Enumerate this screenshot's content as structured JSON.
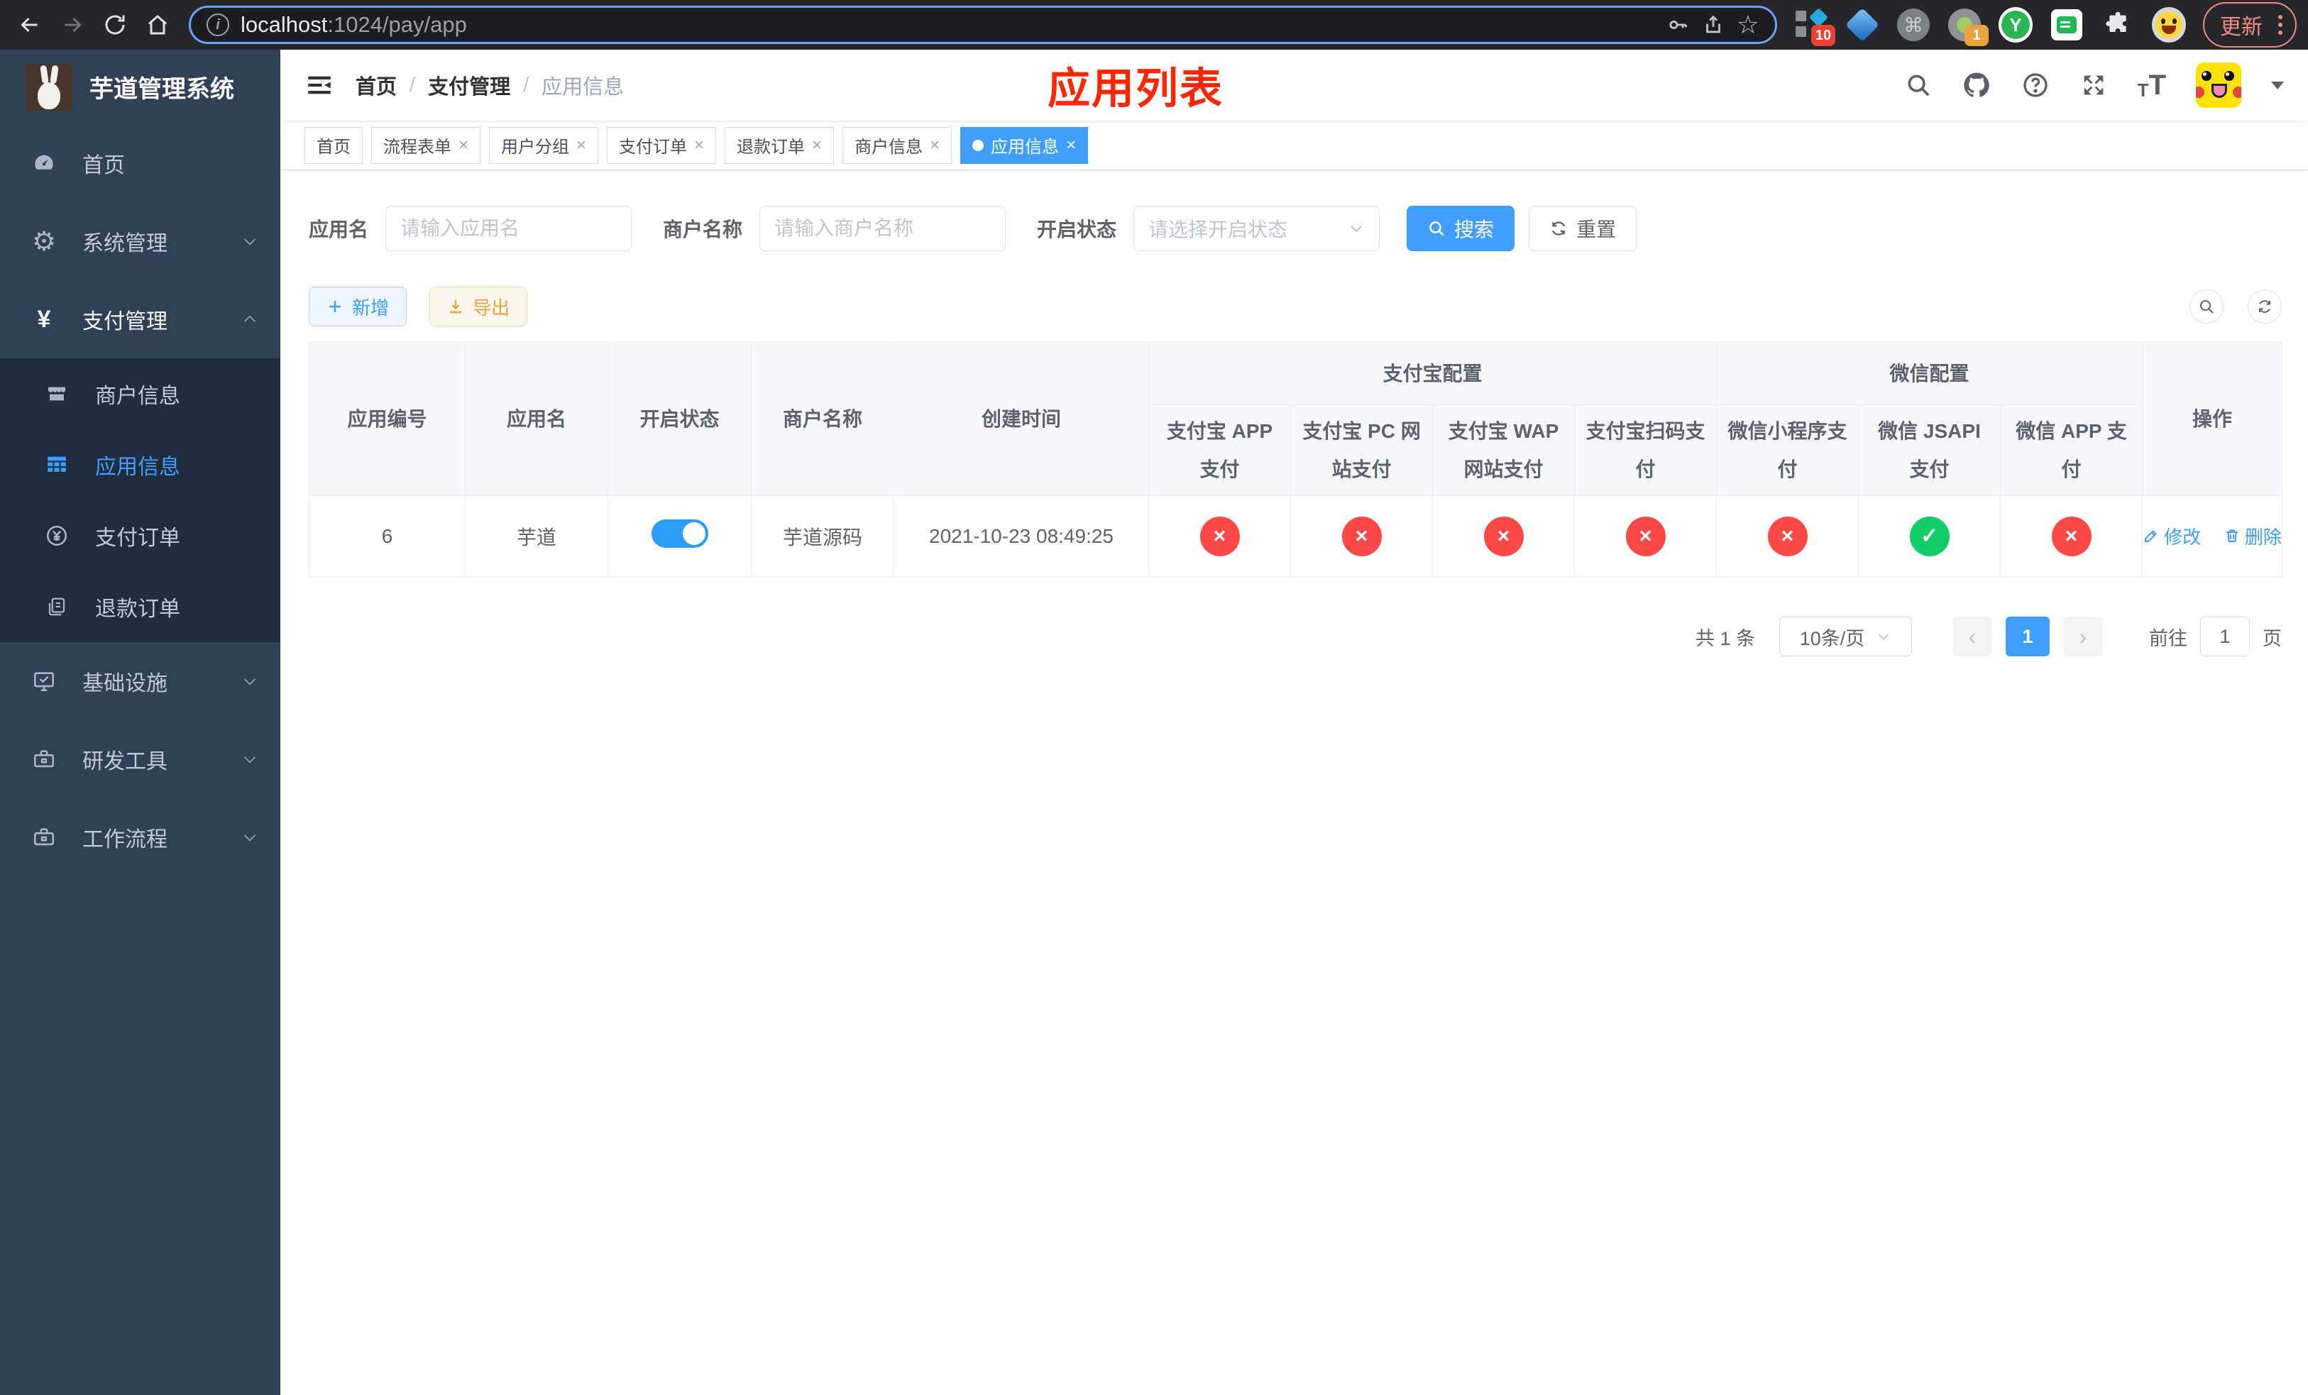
{
  "browser": {
    "url_host": "localhost",
    "url_rest": ":1024/pay/app",
    "ext_badge_grid": "10",
    "ext_badge_proxy": "1",
    "ext_y_label": "Y",
    "update_label": "更新"
  },
  "sidebar": {
    "title": "芋道管理系统",
    "items": [
      {
        "label": "首页"
      },
      {
        "label": "系统管理"
      },
      {
        "label": "支付管理"
      },
      {
        "label": "商户信息"
      },
      {
        "label": "应用信息"
      },
      {
        "label": "支付订单"
      },
      {
        "label": "退款订单"
      },
      {
        "label": "基础设施"
      },
      {
        "label": "研发工具"
      },
      {
        "label": "工作流程"
      }
    ]
  },
  "header": {
    "breadcrumb": {
      "home": "首页",
      "section": "支付管理",
      "current": "应用信息"
    },
    "overlay_title": "应用列表"
  },
  "tabs": [
    {
      "label": "首页",
      "closable": false,
      "active": false
    },
    {
      "label": "流程表单",
      "closable": true,
      "active": false
    },
    {
      "label": "用户分组",
      "closable": true,
      "active": false
    },
    {
      "label": "支付订单",
      "closable": true,
      "active": false
    },
    {
      "label": "退款订单",
      "closable": true,
      "active": false
    },
    {
      "label": "商户信息",
      "closable": true,
      "active": false
    },
    {
      "label": "应用信息",
      "closable": true,
      "active": true
    }
  ],
  "filters": {
    "app_name": {
      "label": "应用名",
      "placeholder": "请输入应用名",
      "value": ""
    },
    "merchant": {
      "label": "商户名称",
      "placeholder": "请输入商户名称",
      "value": ""
    },
    "status": {
      "label": "开启状态",
      "placeholder": "请选择开启状态"
    },
    "search_label": "搜索",
    "reset_label": "重置"
  },
  "toolbar": {
    "add_label": "新增",
    "export_label": "导出"
  },
  "table": {
    "columns": {
      "id": "应用编号",
      "name": "应用名",
      "status": "开启状态",
      "merchant": "商户名称",
      "created": "创建时间",
      "actions": "操作"
    },
    "groups": {
      "alipay": "支付宝配置",
      "wechat": "微信配置"
    },
    "sub_columns": [
      "支付宝 APP 支付",
      "支付宝 PC 网站支付",
      "支付宝 WAP 网站支付",
      "支付宝扫码支付",
      "微信小程序支付",
      "微信 JSAPI 支付",
      "微信 APP 支付"
    ],
    "row": {
      "id": "6",
      "name": "芋道",
      "enabled": true,
      "merchant": "芋道源码",
      "created": "2021-10-23 08:49:25",
      "pay_status": [
        false,
        false,
        false,
        false,
        false,
        true,
        false
      ],
      "edit_label": "修改",
      "delete_label": "删除"
    }
  },
  "pagination": {
    "total": "共 1 条",
    "page_size": "10条/页",
    "current_page": "1",
    "goto_label": "前往",
    "goto_value": "1",
    "unit_label": "页"
  },
  "colors": {
    "primary": "#409eff",
    "success": "#13ce66",
    "danger": "#ff4949",
    "warning": "#e6a23c",
    "sidebar_bg": "#304156",
    "submenu_bg": "#1f2d3d"
  }
}
